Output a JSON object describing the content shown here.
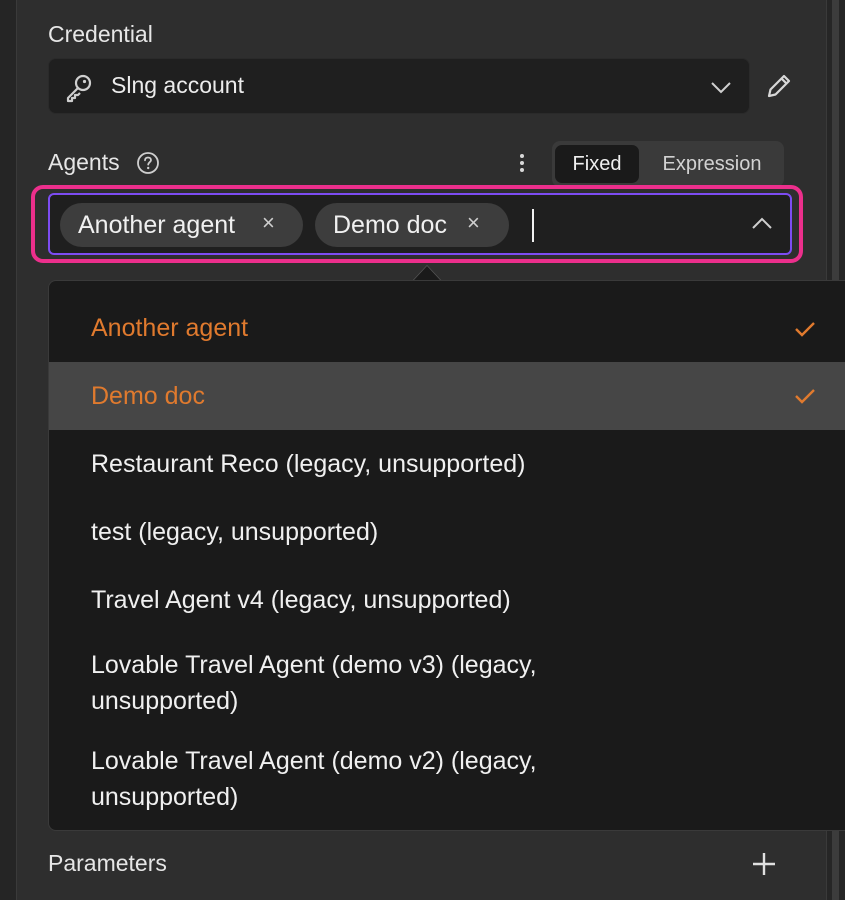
{
  "credential": {
    "label": "Credential",
    "value": "Slng account",
    "icon": "key-icon",
    "dropdown_icon": "chevron-down-icon",
    "edit_icon": "pencil-icon"
  },
  "agents": {
    "label": "Agents",
    "help_icon": "question-circle-icon",
    "menu_icon": "kebab-icon",
    "mode_toggle": {
      "fixed": "Fixed",
      "expression": "Expression",
      "active": "Fixed"
    },
    "chips": [
      {
        "label": "Another agent",
        "remove": "×"
      },
      {
        "label": "Demo doc",
        "remove": "×"
      }
    ],
    "collapse_icon": "chevron-up-icon"
  },
  "dropdown": {
    "options": [
      {
        "label": "Another agent",
        "selected": true,
        "highlighted": false
      },
      {
        "label": "Demo doc",
        "selected": true,
        "highlighted": true
      },
      {
        "label": "Restaurant Reco (legacy, unsupported)",
        "selected": false,
        "highlighted": false
      },
      {
        "label": "test (legacy, unsupported)",
        "selected": false,
        "highlighted": false
      },
      {
        "label": "Travel Agent v4 (legacy, unsupported)",
        "selected": false,
        "highlighted": false
      },
      {
        "label_line1": "Lovable Travel Agent (demo v3) (legacy,",
        "label_line2": "unsupported)",
        "selected": false,
        "highlighted": false
      },
      {
        "label_line1": "Lovable Travel Agent (demo v2) (legacy,",
        "label_line2": "unsupported)",
        "selected": false,
        "highlighted": false
      }
    ],
    "check_icon": "check-icon"
  },
  "parameters": {
    "label": "Parameters",
    "add_icon": "plus-icon"
  },
  "colors": {
    "selected_text": "#e07a2e",
    "focus_ring": "#ec2f8c",
    "input_border": "#7d4cf2",
    "highlight_row": "#464646"
  }
}
